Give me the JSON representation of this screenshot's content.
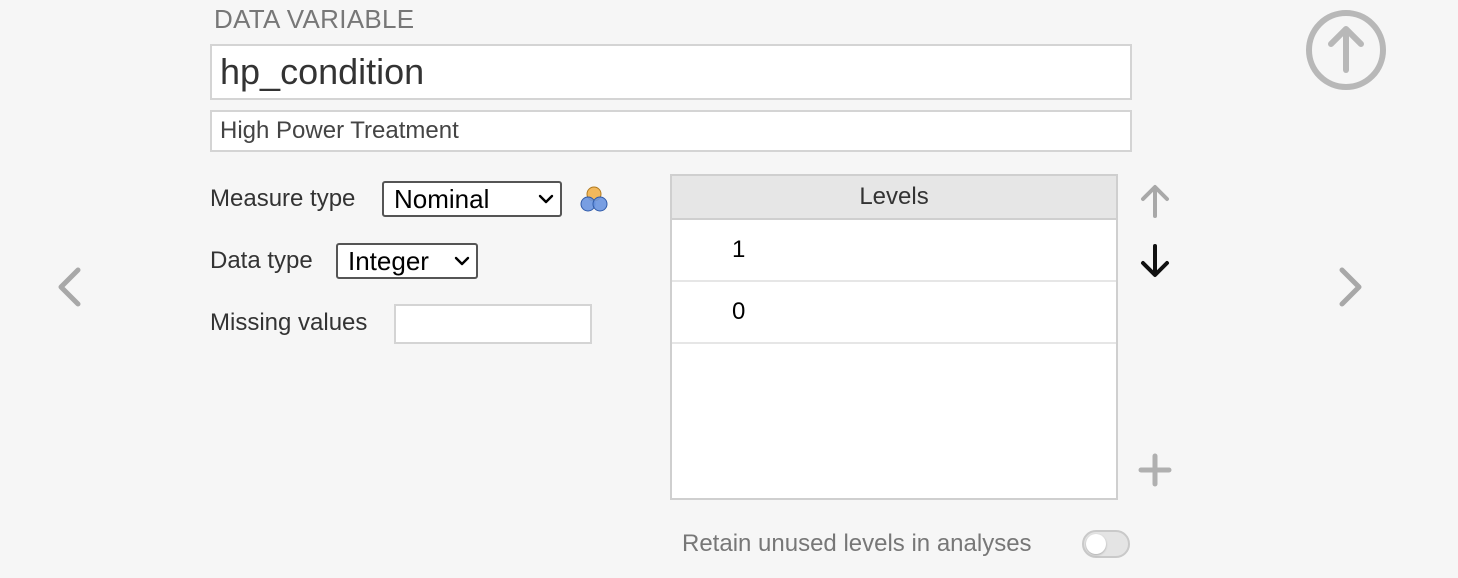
{
  "header": {
    "section_title": "DATA VARIABLE"
  },
  "variable": {
    "name": "hp_condition",
    "description": "High Power Treatment"
  },
  "properties": {
    "measure_type_label": "Measure type",
    "measure_type_value": "Nominal",
    "measure_type_icon": "nominal-circles-icon",
    "data_type_label": "Data type",
    "data_type_value": "Integer",
    "missing_values_label": "Missing values",
    "missing_values_value": ""
  },
  "levels": {
    "header": "Levels",
    "items": [
      "1",
      "0"
    ]
  },
  "retain": {
    "label": "Retain unused levels in analyses",
    "enabled": false
  },
  "colors": {
    "background": "#f6f6f6",
    "border": "#d4d4d4",
    "disabled_icon": "#a8a8a8",
    "nominal_orange": "#f2b85c",
    "nominal_blue": "#6a95e0"
  }
}
